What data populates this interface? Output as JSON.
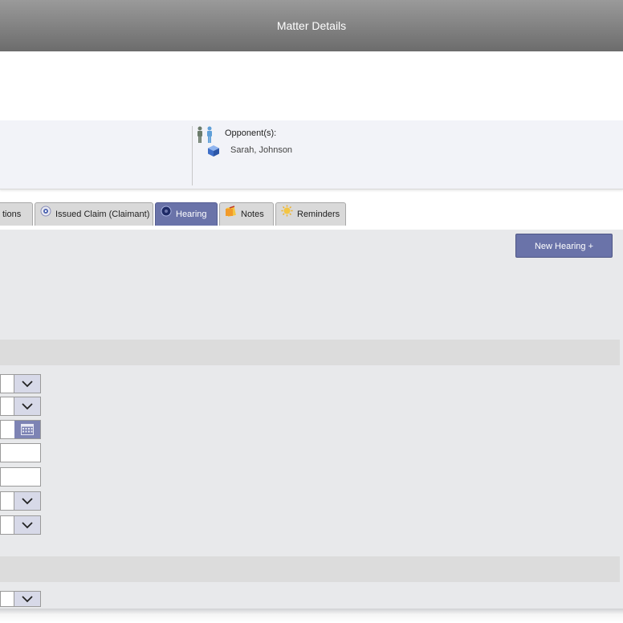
{
  "window": {
    "title": "Matter Details"
  },
  "parties": {
    "opponents_label": "Opponent(s):",
    "opponent_name": "Sarah, Johnson"
  },
  "tabs": [
    {
      "label": "tions",
      "icon": ""
    },
    {
      "label": "Issued Claim (Claimant)",
      "icon": "gear-icon"
    },
    {
      "label": "Hearing",
      "icon": "disc-icon",
      "active": true
    },
    {
      "label": "Notes",
      "icon": "notes-icon"
    },
    {
      "label": "Reminders",
      "icon": "sun-icon"
    }
  ],
  "toolbar": {
    "new_hearing_label": "New Hearing +"
  },
  "colors": {
    "accent": "#6a73a9",
    "titlebar": "#7d7d7d",
    "panel": "#f2f3f8",
    "content_bg": "#e8e9eb"
  }
}
